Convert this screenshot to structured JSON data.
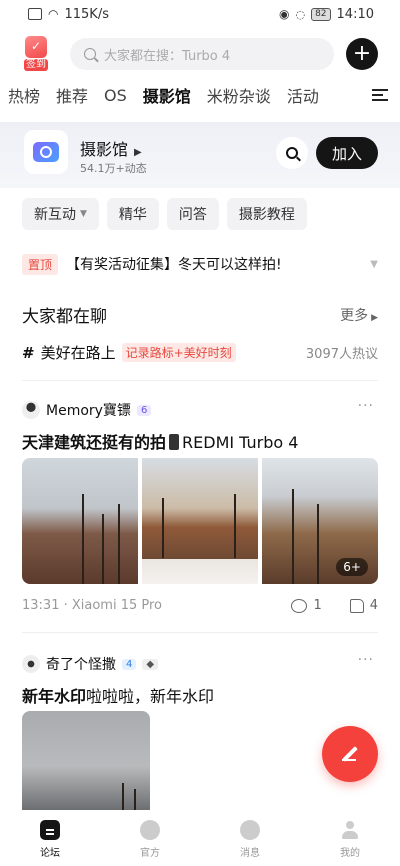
{
  "statusbar": {
    "net_speed": "115K/s",
    "battery": "82",
    "time": "14:10"
  },
  "topbar": {
    "signin_label": "签到",
    "search_placeholder": "大家都在搜：Turbo 4"
  },
  "tabs": [
    "热榜",
    "推荐",
    "OS",
    "摄影馆",
    "米粉杂谈",
    "活动"
  ],
  "active_tab": "摄影馆",
  "forum": {
    "name": "摄影馆",
    "stats": "54.1万+动态",
    "join_label": "加入"
  },
  "chips": [
    {
      "label": "新互动",
      "dropdown": true
    },
    {
      "label": "精华"
    },
    {
      "label": "问答"
    },
    {
      "label": "摄影教程"
    }
  ],
  "pinned": {
    "tag": "置顶",
    "text": "【有奖活动征集】冬天可以这样拍!"
  },
  "talk": {
    "title": "大家都在聊",
    "more": "更多",
    "topic": "美好在路上",
    "topic_tag": "记录路标+美好时刻",
    "heat": "3097人热议"
  },
  "posts": [
    {
      "author": "Memory寶镖",
      "level": "6",
      "title_pre": "天津建筑还挺有的拍",
      "title_post": "REDMI Turbo 4",
      "more_images": "6+",
      "time_device": "13:31 · Xiaomi 15 Pro",
      "comments": "1",
      "likes": "4"
    },
    {
      "author": "奇了个怪撒",
      "level": "4",
      "title_bold": "新年水印",
      "title_rest": "啦啦啦，新年水印"
    }
  ],
  "nav": [
    "论坛",
    "官方",
    "消息",
    "我的"
  ],
  "colors": {
    "accent": "#f4413b",
    "dark": "#151515"
  }
}
